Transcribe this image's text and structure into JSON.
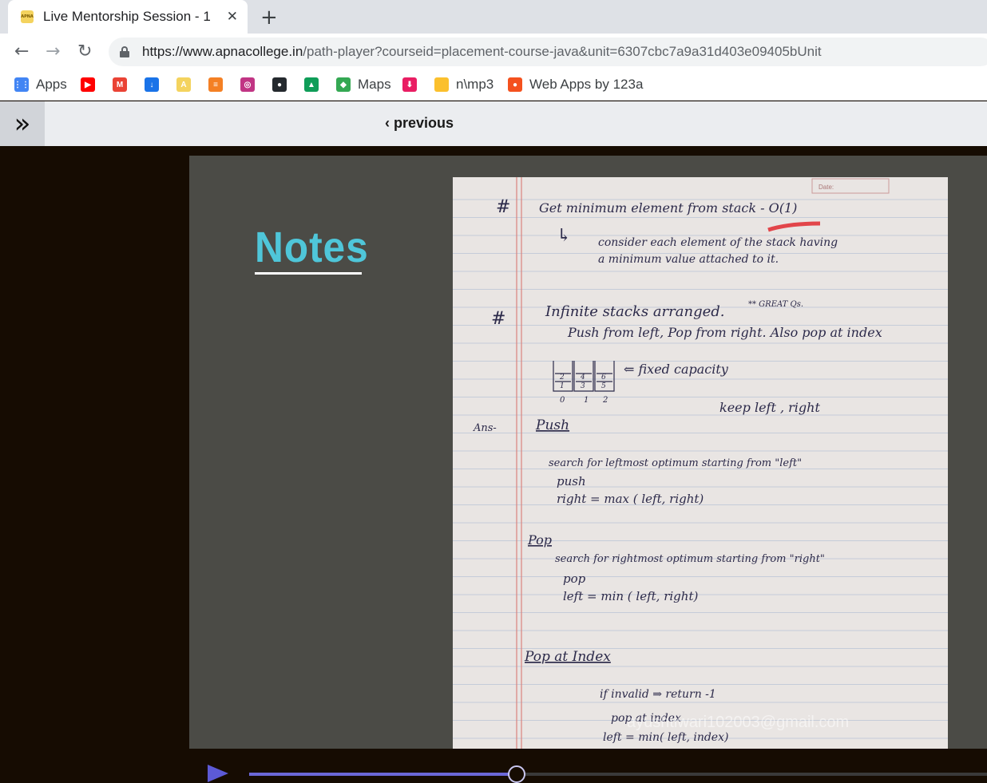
{
  "browser": {
    "tab": {
      "title": "Live Mentorship Session - 1",
      "favicon": "APNA",
      "close_glyph": "✕"
    },
    "new_tab_glyph": "+",
    "nav": {
      "back": "←",
      "forward": "→",
      "reload": "↻"
    },
    "url": {
      "host": "https://www.apnacollege.in",
      "path": "/path-player?courseid=placement-course-java&unit=6307cbc7a9a31d403e09405bUnit"
    },
    "bookmarks": [
      {
        "label": "Apps",
        "icon": "apps-grid-icon",
        "color": "#4285f4"
      },
      {
        "label": "",
        "icon": "youtube-icon",
        "color": "#ff0000"
      },
      {
        "label": "",
        "icon": "gmail-icon",
        "color": "#ea4335"
      },
      {
        "label": "",
        "icon": "cloud-download-icon",
        "color": "#1a73e8"
      },
      {
        "label": "",
        "icon": "apna-icon",
        "color": "#f4d35e"
      },
      {
        "label": "",
        "icon": "stackoverflow-icon",
        "color": "#f48024"
      },
      {
        "label": "",
        "icon": "instagram-icon",
        "color": "#c13584"
      },
      {
        "label": "",
        "icon": "github-icon",
        "color": "#24292e"
      },
      {
        "label": "",
        "icon": "drive-icon",
        "color": "#0f9d58"
      },
      {
        "label": "Maps",
        "icon": "maps-icon",
        "color": "#34a853"
      },
      {
        "label": "",
        "icon": "download-icon",
        "color": "#e91e63"
      },
      {
        "label": "n\\mp3",
        "icon": "folder-icon",
        "color": "#fbc02d"
      },
      {
        "label": "Web Apps by 123a",
        "icon": "webapps-icon",
        "color": "#f4511e"
      }
    ]
  },
  "page": {
    "sidebar_toggle": "»",
    "previous_label": "‹ previous"
  },
  "slide": {
    "title": "Notes",
    "watermark": "ayushtiwari102003@gmail.com",
    "handwriting": {
      "h1_hash": "#",
      "h1": "Get minimum element from stack - O(1)",
      "h1_arrow": "↳",
      "h1_line2": "consider each element of the stack having",
      "h1_line3": "a minimum value attached to it.",
      "h2_hash": "#",
      "h2": "Infinite stacks arranged.",
      "h2_tag": "** GREAT Qs.",
      "h2_line2": "Push from left, Pop from right. Also pop at index",
      "capacity": "⇐ fixed capacity",
      "stack_nums": [
        "2",
        "1",
        "4",
        "3",
        "6",
        "5"
      ],
      "stack_idx": [
        "0",
        "1",
        "2"
      ],
      "keep": "keep   left , right",
      "ans": "Ans-",
      "push_head": "Push",
      "push_l1": "search for leftmost optimum starting from \"left\"",
      "push_l2": "push",
      "push_l3": "right =  max ( left, right)",
      "pop_head": "Pop",
      "pop_l1": "search for rightmost optimum starting from \"right\"",
      "pop_l2": "pop",
      "pop_l3": "left =  min ( left, right)",
      "pidx_head": "Pop at Index",
      "pidx_l1": "if  invalid  ⇒ return  -1",
      "pidx_l2": "pop at index",
      "pidx_l3": "left = min( left, index)",
      "date_label": "Date:"
    }
  },
  "video": {
    "progress": 0.363
  },
  "colors": {
    "accent": "#4fc6d9",
    "player_bar": "#6b68d8",
    "ink": "#2c2a4a"
  }
}
